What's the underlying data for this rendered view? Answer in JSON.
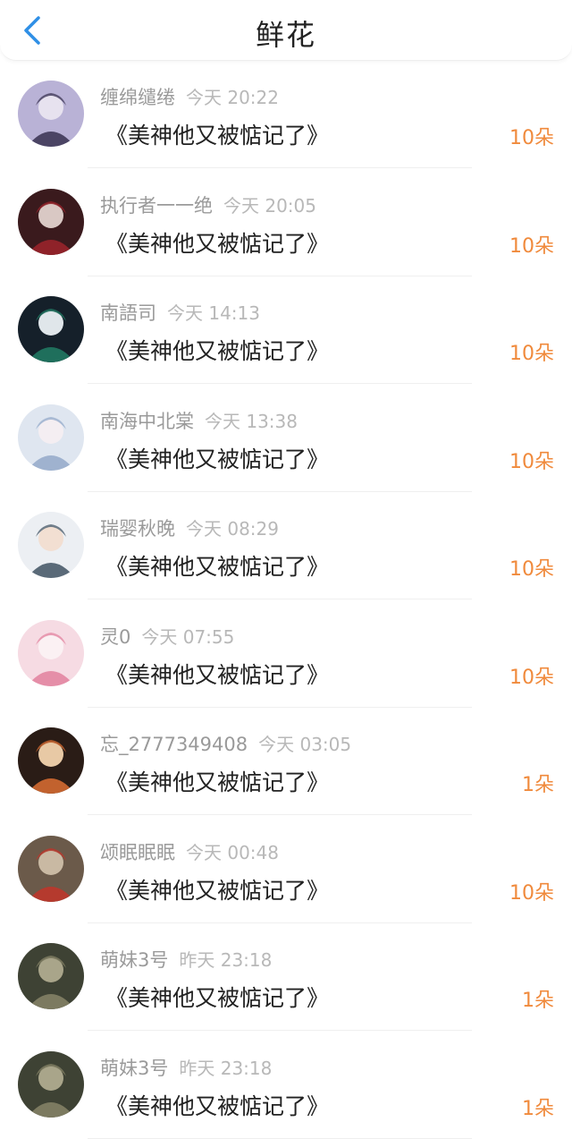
{
  "header": {
    "title": "鲜花",
    "back_icon": "chevron-left-icon",
    "accent_color": "#2f8fe6"
  },
  "items": [
    {
      "name": "缠绵缱绻",
      "time": "今天 20:22",
      "book": "《美神他又被惦记了》",
      "count": "10朵",
      "avatar_colors": [
        "#b9b2d6",
        "#4b4464",
        "#e7e2ef"
      ]
    },
    {
      "name": "执行者一一绝",
      "time": "今天 20:05",
      "book": "《美神他又被惦记了》",
      "count": "10朵",
      "avatar_colors": [
        "#3a1a1d",
        "#8f2229",
        "#d9c8c4"
      ]
    },
    {
      "name": "南語司",
      "time": "今天 14:13",
      "book": "《美神他又被惦记了》",
      "count": "10朵",
      "avatar_colors": [
        "#15202a",
        "#1f6f5c",
        "#e0e6ea"
      ]
    },
    {
      "name": "南海中北棠",
      "time": "今天 13:38",
      "book": "《美神他又被惦记了》",
      "count": "10朵",
      "avatar_colors": [
        "#dfe6f0",
        "#9fb2cf",
        "#f4eef2"
      ]
    },
    {
      "name": "瑞婴秋晚",
      "time": "今天 08:29",
      "book": "《美神他又被惦记了》",
      "count": "10朵",
      "avatar_colors": [
        "#eceff3",
        "#5a6a78",
        "#f2dfd2"
      ]
    },
    {
      "name": "灵0",
      "time": "今天 07:55",
      "book": "《美神他又被惦记了》",
      "count": "10朵",
      "avatar_colors": [
        "#f6dbe3",
        "#e58ea8",
        "#fbf1f3"
      ]
    },
    {
      "name": "忘_2777349408",
      "time": "今天 03:05",
      "book": "《美神他又被惦记了》",
      "count": "1朵",
      "avatar_colors": [
        "#2a1c16",
        "#c2622e",
        "#e8c9a5"
      ]
    },
    {
      "name": "颂眠眠眠",
      "time": "今天 00:48",
      "book": "《美神他又被惦记了》",
      "count": "10朵",
      "avatar_colors": [
        "#6b5a4a",
        "#b53a2e",
        "#c9b9a3"
      ]
    },
    {
      "name": "萌妹3号",
      "time": "昨天 23:18",
      "book": "《美神他又被惦记了》",
      "count": "1朵",
      "avatar_colors": [
        "#3e4234",
        "#7c7a60",
        "#a9a58a"
      ]
    },
    {
      "name": "萌妹3号",
      "time": "昨天 23:18",
      "book": "《美神他又被惦记了》",
      "count": "1朵",
      "avatar_colors": [
        "#3e4234",
        "#7c7a60",
        "#a9a58a"
      ]
    }
  ]
}
